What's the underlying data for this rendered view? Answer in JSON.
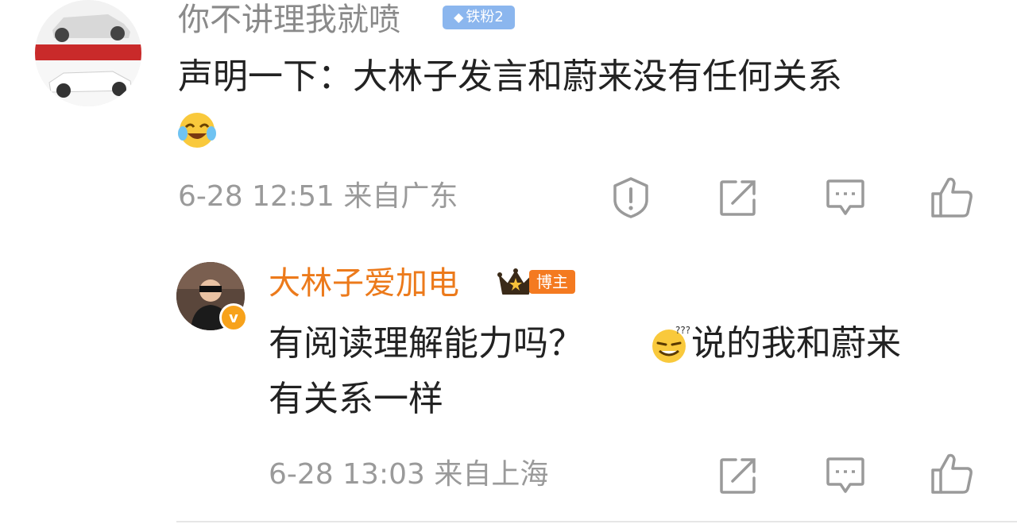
{
  "comment": {
    "author": "你不讲理我就喷",
    "fan_badge": "铁粉2",
    "text": "声明一下：大林子发言和蔚来没有任何关系",
    "emoji": "laughing-crying-emoji",
    "time": "6-28 12:51",
    "location": "来自广东",
    "actions": [
      "report-icon",
      "share-icon",
      "comment-icon",
      "like-icon"
    ]
  },
  "reply": {
    "author": "大林子爱加电",
    "role_badge": "博主",
    "verified_mark": "v",
    "text_part1": "有阅读理解能力吗？",
    "emoji": "smug-emoji",
    "text_part2": "说的我和蔚来",
    "text_line2": "有关系一样",
    "time": "6-28 13:03",
    "location": "来自上海",
    "actions": [
      "share-icon",
      "comment-icon",
      "like-icon"
    ]
  },
  "colors": {
    "author_reply": "#ec7a1b",
    "meta_gray": "#9a9a9a",
    "fan_badge_bg": "#8bb6ee",
    "blogger_badge_bg": "#f47a20"
  }
}
